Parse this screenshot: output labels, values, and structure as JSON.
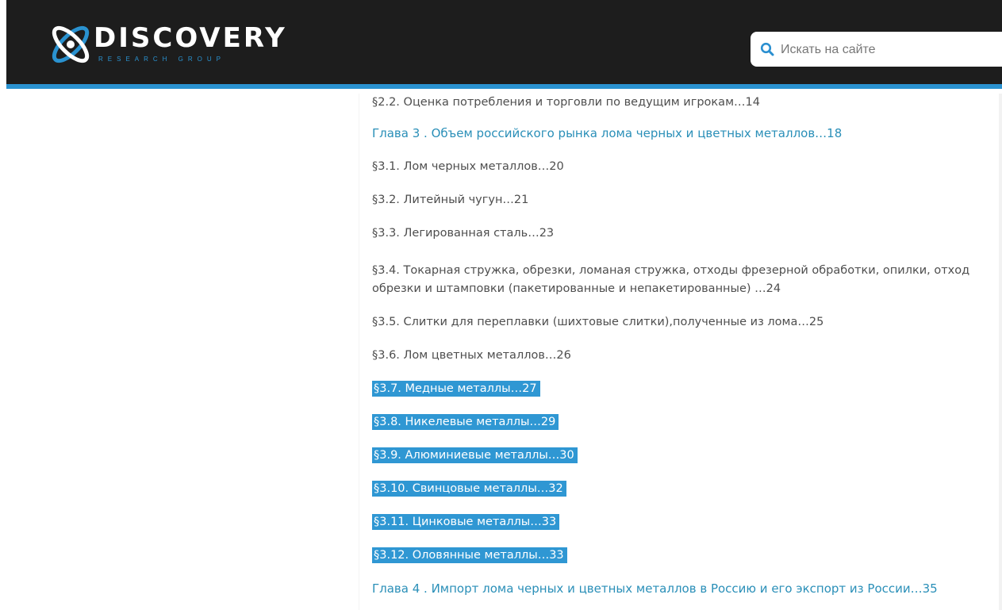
{
  "header": {
    "logo_title": "DISCOVERY",
    "logo_subtitle": "RESEARCH GROUP",
    "search": {
      "placeholder": "Искать на сайте",
      "value": ""
    },
    "colors": {
      "bar": "#1d1d1d",
      "accent": "#2a92d0"
    }
  },
  "toc": {
    "items": [
      {
        "text": "§2.2. Оценка потребления и торговли по ведущим игрокам…14",
        "kind": "section",
        "state": "cut"
      },
      {
        "text": "Глава 3 . Объем российского рынка лома черных и цветных металлов…18",
        "kind": "chapter"
      },
      {
        "text": "§3.1. Лом черных металлов…20",
        "kind": "section"
      },
      {
        "text": "§3.2. Литейный чугун…21",
        "kind": "section"
      },
      {
        "text": "§3.3. Легированная сталь…23",
        "kind": "section"
      },
      {
        "text": "§3.4. Токарная стружка, обрезки, ломаная стружка, отходы фрезерной обработки, опилки, отход",
        "kind": "section"
      },
      {
        "text": "обрезки и штамповки (пакетированные и непакетированные) …24",
        "kind": "section-cont"
      },
      {
        "text": "§3.5. Слитки для переплавки (шихтовые слитки),полученные из лома…25",
        "kind": "section"
      },
      {
        "text": "§3.6. Лом цветных металлов…26",
        "kind": "section"
      },
      {
        "text": "§3.7. Медные металлы…27",
        "kind": "section",
        "state": "selected"
      },
      {
        "text": "§3.8. Никелевые металлы…29",
        "kind": "section",
        "state": "selected"
      },
      {
        "text": "§3.9. Алюминиевые металлы…30",
        "kind": "section",
        "state": "selected"
      },
      {
        "text": "§3.10. Свинцовые металлы…32",
        "kind": "section",
        "state": "selected"
      },
      {
        "text": "§3.11. Цинковые металлы…33",
        "kind": "section",
        "state": "selected"
      },
      {
        "text": "§3.12. Оловянные металлы…33",
        "kind": "section",
        "state": "selected"
      },
      {
        "text": "Глава 4 . Импорт лома черных и цветных металлов в Россию и его экспорт из России…35",
        "kind": "chapter"
      }
    ],
    "colors": {
      "chapter": "#2a8fb8",
      "text": "#4e4e4e",
      "selection": "#2f97d3"
    }
  }
}
